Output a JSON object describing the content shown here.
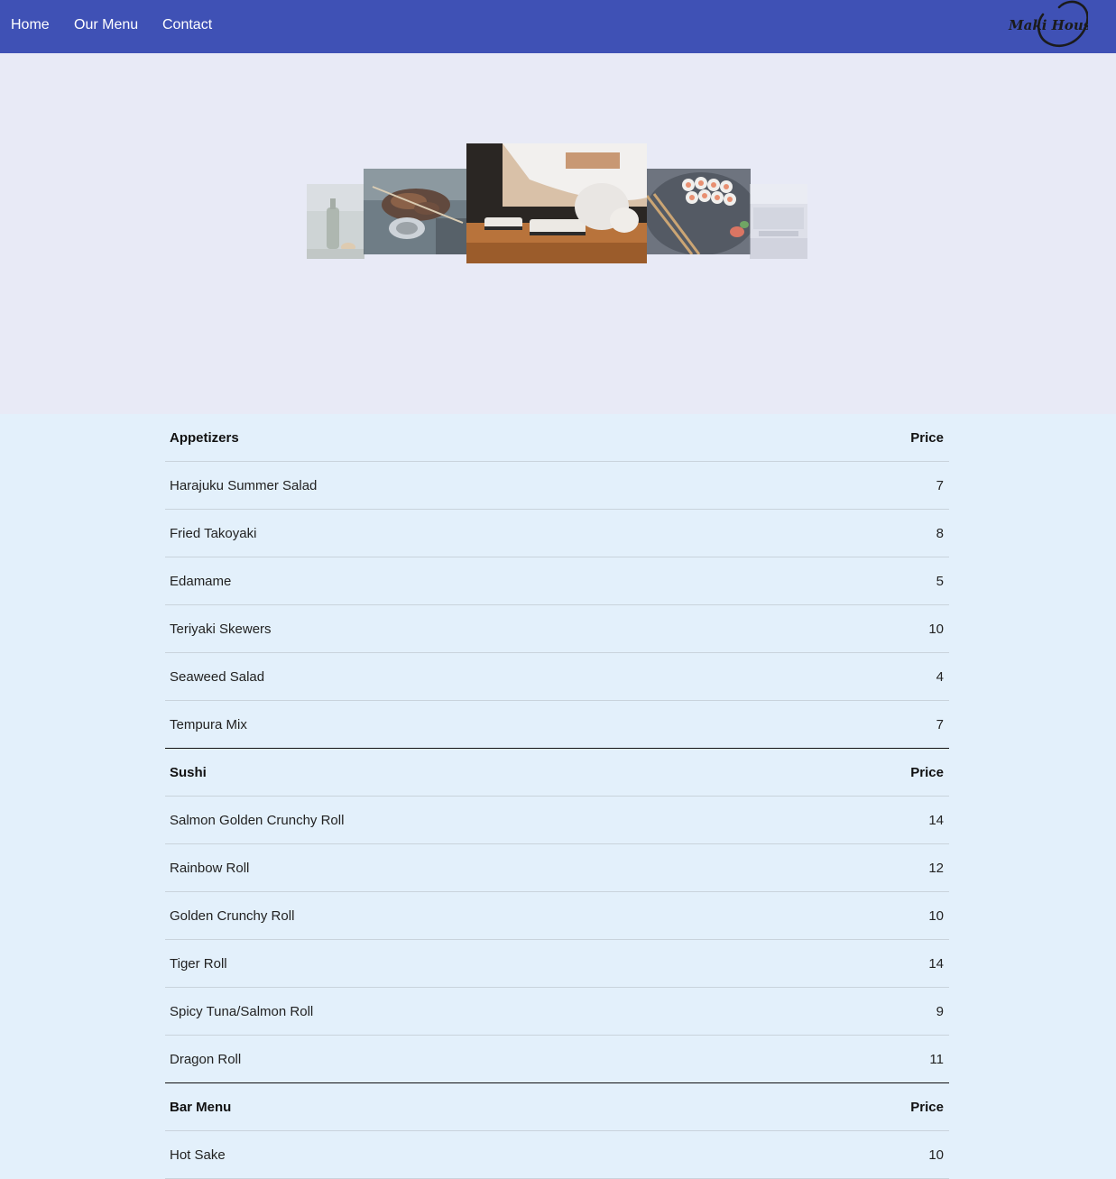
{
  "nav": {
    "links": [
      {
        "label": "Home"
      },
      {
        "label": "Our Menu"
      },
      {
        "label": "Contact"
      }
    ],
    "logo_text": "Maki House"
  },
  "hero": {
    "photos": [
      {
        "subject": "sake bottle"
      },
      {
        "subject": "grilled skewers"
      },
      {
        "subject": "chef rolling sushi"
      },
      {
        "subject": "sushi plate with chopsticks"
      },
      {
        "subject": "restaurant interior"
      }
    ]
  },
  "menu": {
    "sections": [
      {
        "title": "Appetizers",
        "price_header": "Price",
        "items": [
          {
            "name": "Harajuku Summer Salad",
            "price": "7"
          },
          {
            "name": "Fried Takoyaki",
            "price": "8"
          },
          {
            "name": "Edamame",
            "price": "5"
          },
          {
            "name": "Teriyaki Skewers",
            "price": "10"
          },
          {
            "name": "Seaweed Salad",
            "price": "4"
          },
          {
            "name": "Tempura Mix",
            "price": "7"
          }
        ]
      },
      {
        "title": "Sushi",
        "price_header": "Price",
        "items": [
          {
            "name": "Salmon Golden Crunchy Roll",
            "price": "14"
          },
          {
            "name": "Rainbow Roll",
            "price": "12"
          },
          {
            "name": "Golden Crunchy Roll",
            "price": "10"
          },
          {
            "name": "Tiger Roll",
            "price": "14"
          },
          {
            "name": "Spicy Tuna/Salmon Roll",
            "price": "9"
          },
          {
            "name": "Dragon Roll",
            "price": "11"
          }
        ]
      },
      {
        "title": "Bar Menu",
        "price_header": "Price",
        "items": [
          {
            "name": "Hot Sake",
            "price": "10"
          }
        ]
      }
    ]
  },
  "colors": {
    "navbar": "#3f51b5",
    "hero_bg": "#e8eaf6",
    "page_bg": "#e3f0fb"
  }
}
